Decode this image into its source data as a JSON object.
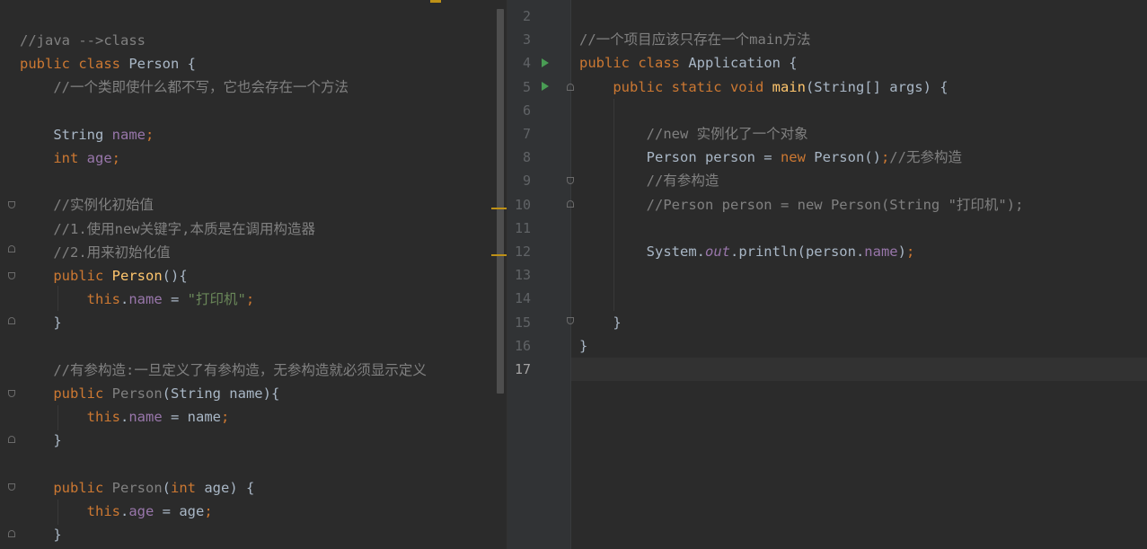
{
  "left_editor": {
    "lines": [
      [
        {
          "t": "//java -->class",
          "c": "cm"
        }
      ],
      [
        {
          "t": "public class ",
          "c": "kw"
        },
        {
          "t": "Person {"
        }
      ],
      [
        {
          "t": "    "
        },
        {
          "t": "//一个类即使什么都不写，它也会存在一个方法",
          "c": "cm"
        }
      ],
      [],
      [
        {
          "t": "    String "
        },
        {
          "t": "name",
          "c": "fd"
        },
        {
          "t": ";",
          "c": "kw"
        }
      ],
      [
        {
          "t": "    "
        },
        {
          "t": "int ",
          "c": "kw"
        },
        {
          "t": "age",
          "c": "fd"
        },
        {
          "t": ";",
          "c": "kw"
        }
      ],
      [],
      [
        {
          "t": "    "
        },
        {
          "t": "//实例化初始值",
          "c": "cm"
        }
      ],
      [
        {
          "t": "    "
        },
        {
          "t": "//1.使用new关键字,本质是在调用构造器",
          "c": "cm"
        }
      ],
      [
        {
          "t": "    "
        },
        {
          "t": "//2.用来初始化值",
          "c": "cm"
        }
      ],
      [
        {
          "t": "    "
        },
        {
          "t": "public ",
          "c": "kw"
        },
        {
          "t": "Person",
          "c": "fn"
        },
        {
          "t": "(){"
        }
      ],
      [
        {
          "t": "        "
        },
        {
          "t": "this",
          "c": "kw"
        },
        {
          "t": "."
        },
        {
          "t": "name",
          "c": "fd"
        },
        {
          "t": " = "
        },
        {
          "t": "\"打印机\"",
          "c": "st"
        },
        {
          "t": ";",
          "c": "kw"
        }
      ],
      [
        {
          "t": "    }"
        }
      ],
      [],
      [
        {
          "t": "    "
        },
        {
          "t": "//有参构造:一旦定义了有参构造，无参构造就必须显示定义",
          "c": "cm"
        }
      ],
      [
        {
          "t": "    "
        },
        {
          "t": "public ",
          "c": "kw"
        },
        {
          "t": "Person",
          "c": "unused"
        },
        {
          "t": "(String name){"
        }
      ],
      [
        {
          "t": "        "
        },
        {
          "t": "this",
          "c": "kw"
        },
        {
          "t": "."
        },
        {
          "t": "name",
          "c": "fd"
        },
        {
          "t": " = name"
        },
        {
          "t": ";",
          "c": "kw"
        }
      ],
      [
        {
          "t": "    }"
        }
      ],
      [],
      [
        {
          "t": "    "
        },
        {
          "t": "public ",
          "c": "kw"
        },
        {
          "t": "Person",
          "c": "unused"
        },
        {
          "t": "("
        },
        {
          "t": "int ",
          "c": "kw"
        },
        {
          "t": "age) {"
        }
      ],
      [
        {
          "t": "        "
        },
        {
          "t": "this",
          "c": "kw"
        },
        {
          "t": "."
        },
        {
          "t": "age",
          "c": "fd"
        },
        {
          "t": " = age"
        },
        {
          "t": ";",
          "c": "kw"
        }
      ],
      [
        {
          "t": "    }"
        }
      ]
    ]
  },
  "right_editor": {
    "line_numbers": [
      "2",
      "3",
      "4",
      "5",
      "6",
      "7",
      "8",
      "9",
      "10",
      "11",
      "12",
      "13",
      "14",
      "15",
      "16",
      "17"
    ],
    "current_line": "17",
    "lines": [
      [],
      [
        {
          "t": "//一个项目应该只存在一个main方法",
          "c": "cm"
        }
      ],
      [
        {
          "t": "public class ",
          "c": "kw"
        },
        {
          "t": "Application {"
        }
      ],
      [
        {
          "t": "    "
        },
        {
          "t": "public static void ",
          "c": "kw"
        },
        {
          "t": "main",
          "c": "fn"
        },
        {
          "t": "(String[] args) {"
        }
      ],
      [],
      [
        {
          "t": "        "
        },
        {
          "t": "//new 实例化了一个对象",
          "c": "cm"
        }
      ],
      [
        {
          "t": "        Person person = "
        },
        {
          "t": "new ",
          "c": "kw"
        },
        {
          "t": "Person()"
        },
        {
          "t": ";",
          "c": "kw"
        },
        {
          "t": "//无参构造",
          "c": "cm"
        }
      ],
      [
        {
          "t": "        "
        },
        {
          "t": "//有参构造",
          "c": "cm"
        }
      ],
      [
        {
          "t": "        "
        },
        {
          "t": "//Person person = new Person(String \"打印机\");",
          "c": "cm"
        }
      ],
      [],
      [
        {
          "t": "        System."
        },
        {
          "t": "out",
          "c": "fd it"
        },
        {
          "t": ".println(person."
        },
        {
          "t": "name",
          "c": "fd"
        },
        {
          "t": ")"
        },
        {
          "t": ";",
          "c": "kw"
        }
      ],
      [],
      [],
      [
        {
          "t": "    }"
        }
      ],
      [
        {
          "t": "}"
        }
      ],
      []
    ]
  },
  "colors": {
    "background": "#2b2b2b",
    "keyword": "#cc7832",
    "comment": "#808080",
    "field": "#9876aa",
    "string": "#6a8759",
    "method": "#ffc66d",
    "run_marker": "#499c54",
    "warning_marker": "#be9117"
  },
  "icons": [
    "run-gutter-icon",
    "fold-marker-icon"
  ]
}
